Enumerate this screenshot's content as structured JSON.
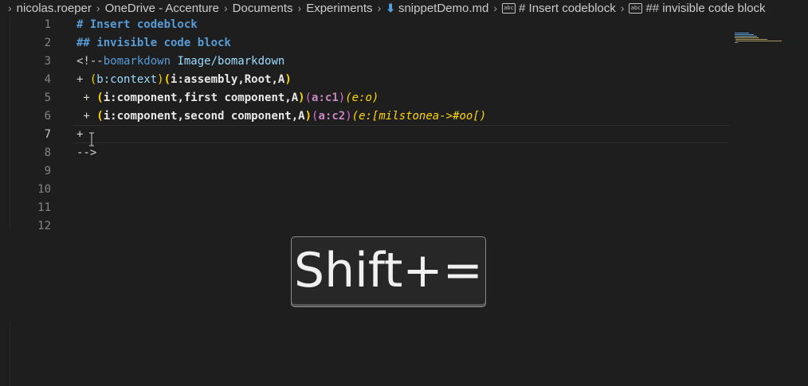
{
  "breadcrumb": {
    "items": [
      {
        "label": "nicolas.roeper",
        "icon": null
      },
      {
        "label": "OneDrive - Accenture",
        "icon": null
      },
      {
        "label": "Documents",
        "icon": null
      },
      {
        "label": "Experiments",
        "icon": null
      },
      {
        "label": "snippetDemo.md",
        "icon": "markdown-file-icon"
      },
      {
        "label": "# Insert codeblock",
        "icon": "string-symbol-icon"
      },
      {
        "label": "## invisible code block",
        "icon": "string-symbol-icon"
      }
    ]
  },
  "editor": {
    "active_line": 7,
    "line_numbers": [
      "1",
      "2",
      "3",
      "4",
      "5",
      "6",
      "7",
      "8",
      "9",
      "10",
      "11",
      "12"
    ],
    "lines": {
      "l1": "# Insert codeblock",
      "l2": "## invisible code block",
      "l3": {
        "open": "<!--",
        "kw": "bomarkdown",
        "rest": " Image/bomarkdown"
      },
      "l4": {
        "plus": "+ ",
        "p1": "(",
        "ctx": "b:context",
        "p2": ")",
        "p3": "(",
        "asm": "i:assembly,Root,A",
        "p4": ")"
      },
      "l5": {
        "plus": " + ",
        "p1": "(",
        "comp": "i:component,first component,A",
        "p2": ")",
        "p3": "(",
        "acode": "a:c1",
        "p4": ")",
        "ecode": "(e:o)"
      },
      "l6": {
        "plus": " + ",
        "p1": "(",
        "comp": "i:component,second component,A",
        "p2": ")",
        "p3": "(",
        "acode": "a:c2",
        "p4": ")",
        "ecode": "(e:[milstonea->#oo[)"
      },
      "l7": "+ ",
      "l8": "-->"
    }
  },
  "key_overlay": {
    "text": "Shift+="
  },
  "colors": {
    "background": "#1e1e1e",
    "heading": "#569cd6",
    "bracket_yellow": "#ffd700",
    "bracket_purple": "#da70d6",
    "keyword_lightblue": "#9cdcfe"
  }
}
